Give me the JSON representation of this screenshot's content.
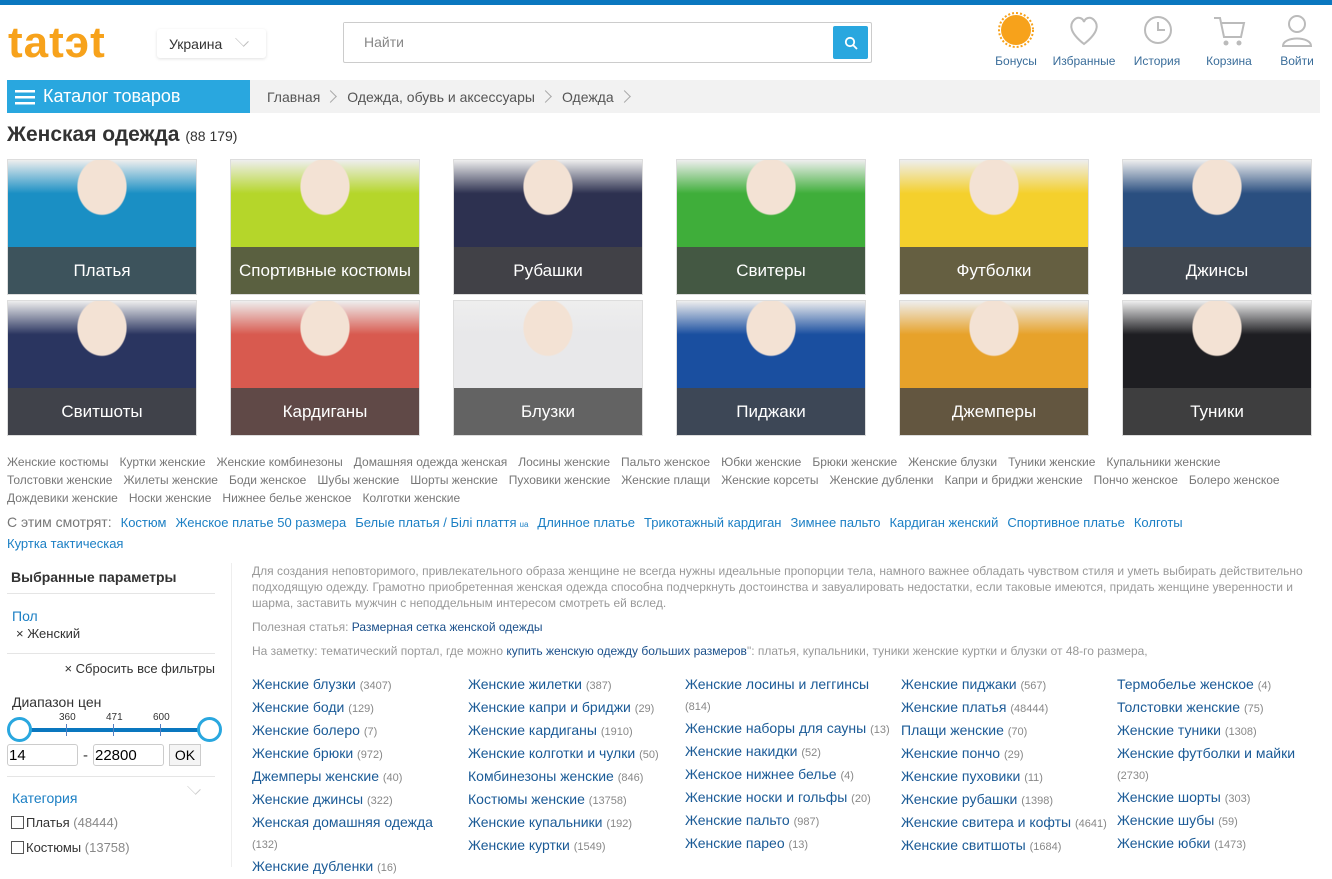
{
  "header": {
    "logo": "tatэt",
    "country": "Украина",
    "search_placeholder": "Найти",
    "icons": [
      {
        "name": "bonus-icon",
        "label": "Бонусы"
      },
      {
        "name": "heart-icon",
        "label": "Избранные"
      },
      {
        "name": "history-icon",
        "label": "История"
      },
      {
        "name": "cart-icon",
        "label": "Корзина"
      },
      {
        "name": "user-icon",
        "label": "Войти"
      }
    ]
  },
  "catalog_label": "Каталог товаров",
  "breadcrumb": [
    "Главная",
    "Одежда, обувь и аксессуары",
    "Одежда"
  ],
  "page": {
    "title": "Женская одежда",
    "count": "(88 179)"
  },
  "tiles": [
    {
      "label": "Платья",
      "color": "#1a8fc4"
    },
    {
      "label": "Спортивные костюмы",
      "color": "#b5d62a"
    },
    {
      "label": "Рубашки",
      "color": "#2d3150"
    },
    {
      "label": "Свитеры",
      "color": "#3fae3a"
    },
    {
      "label": "Футболки",
      "color": "#f4d02c"
    },
    {
      "label": "Джинсы",
      "color": "#2a4f80"
    },
    {
      "label": "Свитшоты",
      "color": "#2a3560"
    },
    {
      "label": "Кардиганы",
      "color": "#d85a4f"
    },
    {
      "label": "Блузки",
      "color": "#e8e8ea"
    },
    {
      "label": "Пиджаки",
      "color": "#1a4fa0"
    },
    {
      "label": "Джемперы",
      "color": "#e7a22a"
    },
    {
      "label": "Туники",
      "color": "#1e1e22"
    }
  ],
  "tags": [
    "Женские костюмы",
    "Куртки женские",
    "Женские комбинезоны",
    "Домашняя одежда женская",
    "Лосины женские",
    "Пальто женское",
    "Юбки женские",
    "Брюки женские",
    "Женские блузки",
    "Туники женские",
    "Купальники женские",
    "Толстовки женские",
    "Жилеты женские",
    "Боди женское",
    "Шубы женские",
    "Шорты женские",
    "Пуховики женские",
    "Женские плащи",
    "Женские корсеты",
    "Женские дубленки",
    "Капри и бриджи женские",
    "Пончо женское",
    "Болеро женское",
    "Дождевики женские",
    "Носки женские",
    "Нижнее белье женское",
    "Колготки женские"
  ],
  "seen": {
    "label": "С этим смотрят:",
    "items": [
      "Костюм",
      "Женское платье 50 размера",
      "Белые платья / Білі плаття",
      "Длинное платье",
      "Трикотажный кардиган",
      "Зимнее пальто",
      "Кардиган женский",
      "Спортивное платье",
      "Колготы",
      "Куртка тактическая"
    ],
    "ua": "ua"
  },
  "sidebar": {
    "selected_title": "Выбранные параметры",
    "filter_group": "Пол",
    "filter_value": "× Женский",
    "reset": "× Сбросить все фильтры",
    "price_title": "Диапазон цен",
    "ticks": [
      "360",
      "471",
      "600"
    ],
    "min": "14",
    "max": "22800",
    "ok": "OK",
    "category_title": "Категория",
    "categories": [
      {
        "label": "Платья",
        "count": "(48444)"
      },
      {
        "label": "Костюмы",
        "count": "(13758)"
      }
    ]
  },
  "desc": {
    "text": "Для создания неповторимого, привлекательного образа женщине не всегда нужны идеальные пропорции тела, намного важнее обладать чувством стиля и уметь выбирать действительно подходящую одежду. Грамотно приобретенная женская одежда способна подчеркнуть достоинства и завуалировать недостатки, если таковые имеются, придать женщине уверенности и шарма, заставить мужчин с неподдельным интересом смотреть ей вслед.",
    "article_label": "Полезная статья:",
    "article_link": "Размерная сетка женской одежды",
    "note_label": "На заметку: тематический портал, где можно",
    "note_link": "купить женскую одежду больших размеров",
    "note_rest": "\": платья, купальники, туники женские куртки и блузки от 48-го размера,"
  },
  "columns": [
    [
      [
        "Женские блузки",
        "(3407)"
      ],
      [
        "Женские боди",
        "(129)"
      ],
      [
        "Женские болеро",
        "(7)"
      ],
      [
        "Женские брюки",
        "(972)"
      ],
      [
        "Джемперы женские",
        "(40)"
      ],
      [
        "Женские джинсы",
        "(322)"
      ],
      [
        "Женская домашняя одежда",
        "(132)"
      ],
      [
        "Женские дубленки",
        "(16)"
      ]
    ],
    [
      [
        "Женские жилетки",
        "(387)"
      ],
      [
        "Женские капри и бриджи",
        "(29)"
      ],
      [
        "Женские кардиганы",
        "(1910)"
      ],
      [
        "Женские колготки и чулки",
        "(50)"
      ],
      [
        "Комбинезоны женские",
        "(846)"
      ],
      [
        "Костюмы женские",
        "(13758)"
      ],
      [
        "Женские купальники",
        "(192)"
      ],
      [
        "Женские куртки",
        "(1549)"
      ]
    ],
    [
      [
        "Женские лосины и леггинсы",
        "(814)"
      ],
      [
        "Женские наборы для сауны",
        "(13)"
      ],
      [
        "Женские накидки",
        "(52)"
      ],
      [
        "Женское нижнее белье",
        "(4)"
      ],
      [
        "Женские носки и гольфы",
        "(20)"
      ],
      [
        "Женские пальто",
        "(987)"
      ],
      [
        "Женские парео",
        "(13)"
      ]
    ],
    [
      [
        "Женские пиджаки",
        "(567)"
      ],
      [
        "Женские платья",
        "(48444)"
      ],
      [
        "Плащи женские",
        "(70)"
      ],
      [
        "Женские пончо",
        "(29)"
      ],
      [
        "Женские пуховики",
        "(11)"
      ],
      [
        "Женские рубашки",
        "(1398)"
      ],
      [
        "Женские свитера и кофты",
        "(4641)"
      ],
      [
        "Женские свитшоты",
        "(1684)"
      ]
    ],
    [
      [
        "Термобелье женское",
        "(4)"
      ],
      [
        "Толстовки женские",
        "(75)"
      ],
      [
        "Женские туники",
        "(1308)"
      ],
      [
        "Женские футболки и майки",
        "(2730)"
      ],
      [
        "Женские шорты",
        "(303)"
      ],
      [
        "Женские шубы",
        "(59)"
      ],
      [
        "Женские юбки",
        "(1473)"
      ]
    ]
  ]
}
